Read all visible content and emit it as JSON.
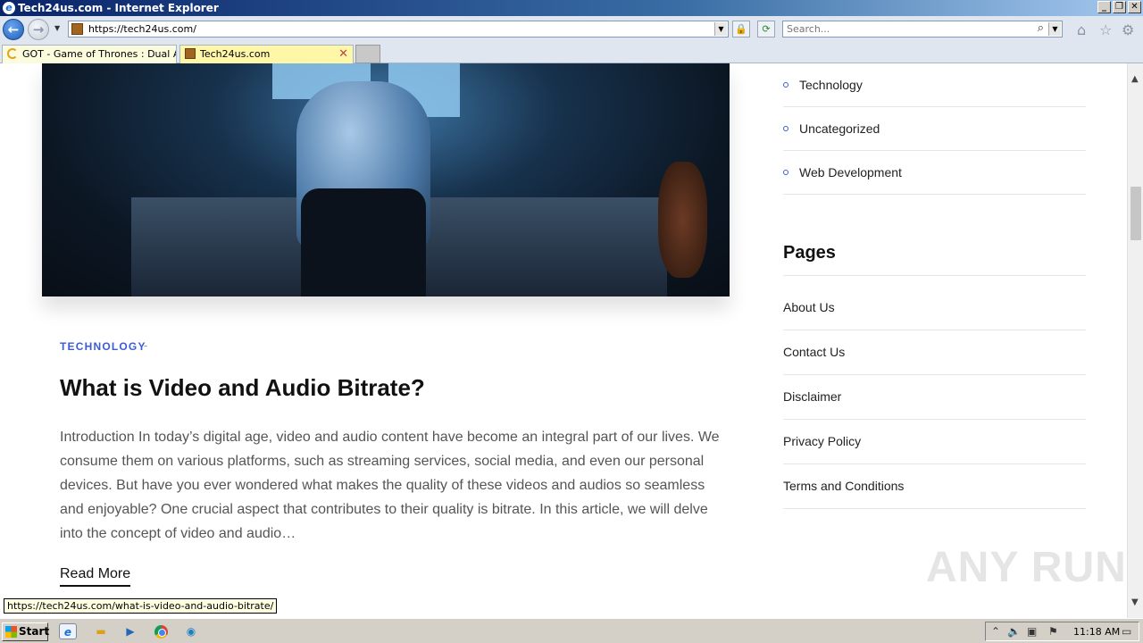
{
  "window": {
    "title": "Tech24us.com - Internet Explorer",
    "controls": [
      "minimize-icon",
      "restore-icon",
      "close-icon"
    ]
  },
  "navbar": {
    "address_url": "https://tech24us.com/",
    "search_placeholder": "Search..."
  },
  "tabs": [
    {
      "label": "GOT - Game of Thrones : Dual A...",
      "active": false,
      "loading": true
    },
    {
      "label": "Tech24us.com",
      "active": true
    }
  ],
  "post": {
    "category": "TECHNOLOGY",
    "category_separator": "-",
    "title": "What is Video and Audio Bitrate?",
    "excerpt": "Introduction In today’s digital age, video and audio content have become an integral part of our lives. We consume them on various platforms, such as streaming services, social media, and even our personal devices. But have you ever wondered what makes the quality of these videos and audios so seamless and enjoyable? One crucial aspect that contributes to their quality is bitrate. In this article, we will delve into the concept of video and audio…",
    "read_more": "Read More"
  },
  "sidebar": {
    "categories": [
      {
        "label": "Technology"
      },
      {
        "label": "Uncategorized"
      },
      {
        "label": "Web Development"
      }
    ],
    "pages_heading": "Pages",
    "pages": [
      {
        "label": "About Us"
      },
      {
        "label": "Contact Us"
      },
      {
        "label": "Disclaimer"
      },
      {
        "label": "Privacy Policy"
      },
      {
        "label": "Terms and Conditions"
      }
    ]
  },
  "watermark": "ANY RUN",
  "status_bar": {
    "hover_url": "https://tech24us.com/what-is-video-and-audio-bitrate/"
  },
  "taskbar": {
    "start_label": "Start",
    "clock": "11:18 AM"
  },
  "colors": {
    "accent": "#3b5bdb",
    "title_text": "#111111",
    "body_text": "#555555"
  }
}
